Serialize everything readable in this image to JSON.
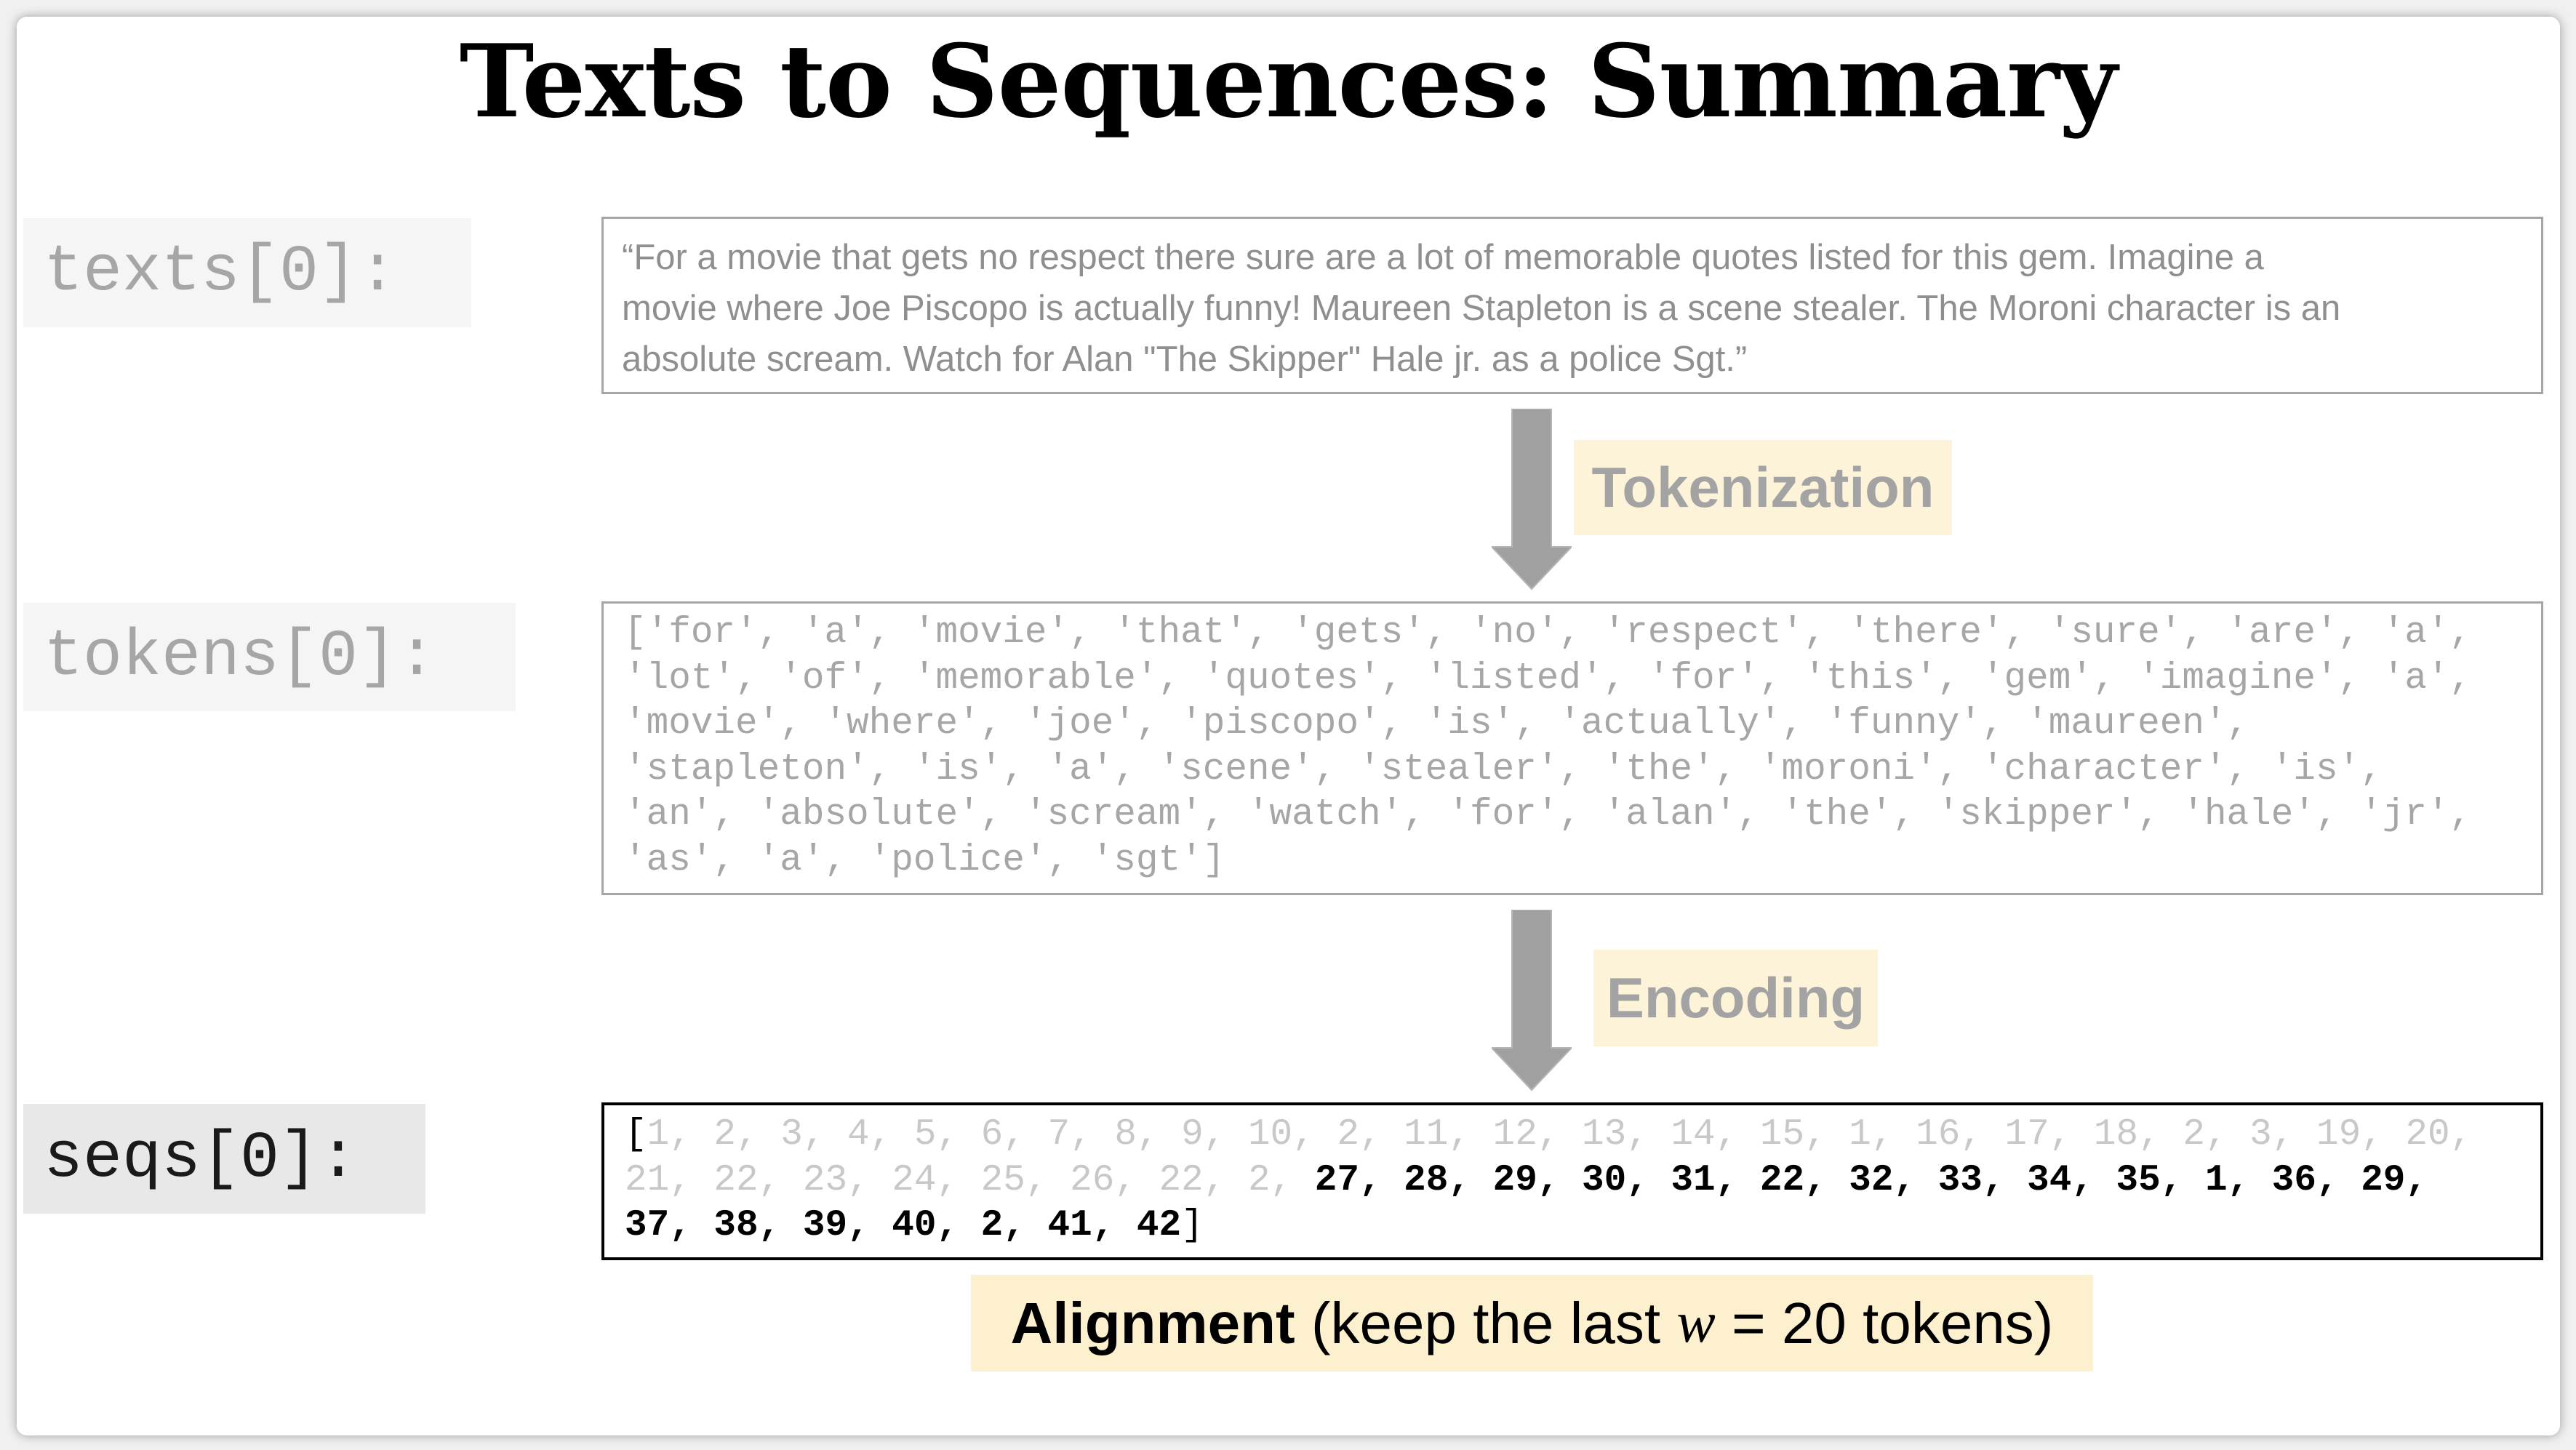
{
  "title": "Texts to Sequences: Summary",
  "texts": {
    "label": "texts[0]:",
    "lines": [
      "“For a movie that gets no respect there sure are a lot of memorable quotes listed for this gem. Imagine a",
      "movie where Joe Piscopo is actually funny! Maureen Stapleton is a scene stealer. The Moroni character is an",
      "absolute scream. Watch for Alan \"The Skipper\" Hale jr. as a police Sgt.”"
    ]
  },
  "tokenization": {
    "label": "Tokenization"
  },
  "tokens": {
    "label": "tokens[0]:",
    "lines": [
      "['for', 'a', 'movie', 'that', 'gets', 'no', 'respect', 'there', 'sure', 'are', 'a',",
      "'lot', 'of', 'memorable', 'quotes', 'listed', 'for', 'this', 'gem', 'imagine', 'a',",
      "'movie', 'where', 'joe', 'piscopo', 'is', 'actually', 'funny', 'maureen',",
      "'stapleton', 'is', 'a', 'scene', 'stealer', 'the', 'moroni', 'character', 'is',",
      "'an', 'absolute', 'scream', 'watch', 'for', 'alan', 'the', 'skipper', 'hale', 'jr',",
      "'as', 'a', 'police', 'sgt']"
    ]
  },
  "encoding": {
    "label": "Encoding"
  },
  "seqs": {
    "label": "seqs[0]:",
    "open_bracket": "[",
    "line1_dropped": "1, 2, 3, 4, 5, 6, 7, 8, 9, 10, 2, 11, 12, 13, 14, 15, 1, 16, 17, 18, 2, 3, 19, 20,",
    "line2_dropped": "21, 22, 23, 24, 25, 26, 22, 2, ",
    "line2_kept": "27, 28, 29, 30, 31, 22, 32, 33, 34, 35, 1, 36, 29,",
    "line3_kept": "37, 38, 39, 40, 2, 41, 42",
    "close_bracket": "]"
  },
  "alignment": {
    "bold": "Alignment",
    "text_before": " (keep the last ",
    "variable": "w",
    "text_after": " = 20 tokens)"
  },
  "colors": {
    "arrow": "#a0a0a0",
    "highlight": "#fcf0cf",
    "dropped": "#c8c8c8",
    "kept": "#000000"
  }
}
